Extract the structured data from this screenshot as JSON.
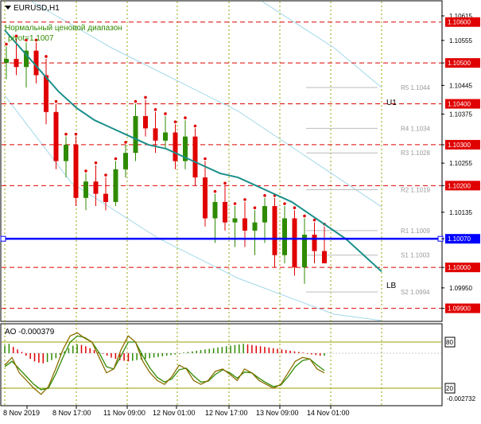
{
  "header": {
    "symbol": "EURUSD,H1",
    "indicator_name": "Нормальный ценовой диапазон",
    "pivot_label": "pivot=1.1007"
  },
  "colors": {
    "background": "#ffffff",
    "bull_candle": "#2e8b00",
    "bear_candle": "#e00000",
    "moving_average": "#1a8f8a",
    "channel": "#a0d8ea",
    "level_line": "#e00000",
    "price_line": "#0000ff",
    "ao_up": "#2e8b00",
    "ao_down": "#e00000",
    "stoch_main": "#8b6f00",
    "stoch_signal": "#2e8b00",
    "grid": "#9aa000",
    "axis": "#000000"
  },
  "chart_data": {
    "type": "candlestick",
    "main_panel": {
      "y_range": [
        1.0985,
        1.0865
      ],
      "y_range_note": "top to bottom",
      "tick_labels": [
        "1.10615",
        "1.10555",
        "1.10500",
        "1.10445",
        "1.10375",
        "1.10300",
        "1.10255",
        "1.10200",
        "1.10135",
        "1.10070",
        "1.10000",
        "1.09950",
        "1.09900"
      ],
      "tick_values": [
        1.10615,
        1.10555,
        1.105,
        1.10445,
        1.10375,
        1.103,
        1.10255,
        1.102,
        1.10135,
        1.1007,
        1.1,
        1.0995,
        1.099
      ],
      "red_levels": [
        1.106,
        1.105,
        1.104,
        1.103,
        1.102,
        1.1,
        1.099
      ],
      "red_level_labels": [
        "1.10600",
        "1.10500",
        "1.10400",
        "1.10300",
        "1.10200",
        "1.10000",
        "1.09900"
      ],
      "current_price": 1.1007,
      "current_price_label": "1.10070",
      "current_close": 1.1001,
      "pivot_labels": [
        {
          "text": "R5 1.1044",
          "value": 1.1044
        },
        {
          "text": "R4 1.1034",
          "value": 1.1034
        },
        {
          "text": "R3 1.1028",
          "value": 1.1028
        },
        {
          "text": "R2 1.1019",
          "value": 1.1019
        },
        {
          "text": "R1 1.1009",
          "value": 1.1009
        },
        {
          "text": "S1 1.1003",
          "value": 1.1003
        },
        {
          "text": "S2 1.0994",
          "value": 1.0994
        }
      ],
      "line_tags": [
        "U1",
        "LB"
      ],
      "ma_values": [
        1.1058,
        1.1053,
        1.1048,
        1.1043,
        1.1039,
        1.1036,
        1.1034,
        1.1032,
        1.103,
        1.1029,
        1.1027,
        1.1025,
        1.1023,
        1.1022,
        1.102,
        1.1018,
        1.1016,
        1.1013,
        1.101,
        1.1007,
        1.1003,
        1.0999
      ],
      "candles": [
        {
          "o": 1.105,
          "h": 1.1054,
          "l": 1.1046,
          "c": 1.1051
        },
        {
          "o": 1.1051,
          "h": 1.1056,
          "l": 1.1047,
          "c": 1.1049
        },
        {
          "o": 1.1049,
          "h": 1.1055,
          "l": 1.1044,
          "c": 1.1053
        },
        {
          "o": 1.1053,
          "h": 1.1055,
          "l": 1.1045,
          "c": 1.1047
        },
        {
          "o": 1.1047,
          "h": 1.1051,
          "l": 1.1035,
          "c": 1.1038
        },
        {
          "o": 1.1038,
          "h": 1.104,
          "l": 1.1024,
          "c": 1.1026
        },
        {
          "o": 1.1026,
          "h": 1.1032,
          "l": 1.1022,
          "c": 1.103
        },
        {
          "o": 1.103,
          "h": 1.1032,
          "l": 1.1015,
          "c": 1.1017
        },
        {
          "o": 1.1017,
          "h": 1.1023,
          "l": 1.1014,
          "c": 1.1021
        },
        {
          "o": 1.1021,
          "h": 1.1025,
          "l": 1.1015,
          "c": 1.1018
        },
        {
          "o": 1.1018,
          "h": 1.1022,
          "l": 1.1014,
          "c": 1.1016
        },
        {
          "o": 1.1016,
          "h": 1.1026,
          "l": 1.1015,
          "c": 1.1024
        },
        {
          "o": 1.1024,
          "h": 1.103,
          "l": 1.1022,
          "c": 1.1028
        },
        {
          "o": 1.1028,
          "h": 1.104,
          "l": 1.1026,
          "c": 1.1037
        },
        {
          "o": 1.1037,
          "h": 1.1041,
          "l": 1.1032,
          "c": 1.1034
        },
        {
          "o": 1.1034,
          "h": 1.1038,
          "l": 1.1028,
          "c": 1.1031
        },
        {
          "o": 1.1031,
          "h": 1.1037,
          "l": 1.1029,
          "c": 1.1033
        },
        {
          "o": 1.1033,
          "h": 1.1035,
          "l": 1.1024,
          "c": 1.1026
        },
        {
          "o": 1.1026,
          "h": 1.1036,
          "l": 1.1024,
          "c": 1.1032
        },
        {
          "o": 1.1032,
          "h": 1.1034,
          "l": 1.102,
          "c": 1.1022
        },
        {
          "o": 1.1022,
          "h": 1.1026,
          "l": 1.101,
          "c": 1.1012
        },
        {
          "o": 1.1012,
          "h": 1.1018,
          "l": 1.1006,
          "c": 1.1016
        },
        {
          "o": 1.1016,
          "h": 1.102,
          "l": 1.1009,
          "c": 1.1011
        },
        {
          "o": 1.1011,
          "h": 1.1015,
          "l": 1.1005,
          "c": 1.1012
        },
        {
          "o": 1.1012,
          "h": 1.1016,
          "l": 1.1005,
          "c": 1.1009
        },
        {
          "o": 1.1009,
          "h": 1.1014,
          "l": 1.1003,
          "c": 1.1011
        },
        {
          "o": 1.1011,
          "h": 1.1017,
          "l": 1.1006,
          "c": 1.1015
        },
        {
          "o": 1.1015,
          "h": 1.1017,
          "l": 1.1,
          "c": 1.1003
        },
        {
          "o": 1.1003,
          "h": 1.1015,
          "l": 1.1001,
          "c": 1.1012
        },
        {
          "o": 1.1012,
          "h": 1.1014,
          "l": 1.0998,
          "c": 1.1
        },
        {
          "o": 1.1,
          "h": 1.1012,
          "l": 1.0996,
          "c": 1.1008
        },
        {
          "o": 1.1008,
          "h": 1.1011,
          "l": 1.1001,
          "c": 1.1004
        },
        {
          "o": 1.1004,
          "h": 1.101,
          "l": 1.1001,
          "c": 1.1001
        }
      ]
    },
    "ao_panel": {
      "label": "AO",
      "value_label": "-0.000379",
      "value": -0.000379,
      "levels": [
        "80",
        "20"
      ],
      "bottom_label": "-0.002732",
      "histogram": [
        0.0012,
        0.0015,
        0.001,
        0.0006,
        0.0002,
        -0.0004,
        -0.0009,
        -0.0013,
        -0.0015,
        -0.0016,
        -0.0014,
        -0.0011,
        -0.0008,
        -0.0003,
        0.0003,
        0.0008,
        0.0012,
        0.0014,
        0.0013,
        0.0011,
        0.0008,
        0.0005,
        0.0002,
        -0.0001,
        -0.0004,
        -0.0007,
        -0.0009,
        -0.0011,
        -0.0012,
        -0.0013,
        -0.0012,
        -0.0011,
        -0.001,
        -0.0009,
        -0.0008,
        -0.0007,
        -0.0006,
        -0.0005,
        -0.0004,
        -0.0003,
        -0.0002,
        -0.0001,
        0.0001,
        0.0002,
        0.0003,
        0.0004,
        0.0005,
        0.0006,
        0.0007,
        0.0008,
        0.0009,
        0.001,
        0.0011,
        0.0012,
        0.0013,
        0.0014,
        0.0015,
        0.0014,
        0.0013,
        0.0012,
        0.0011,
        0.001,
        0.0009,
        0.0008,
        0.0007,
        0.0006,
        0.0005,
        0.0004,
        0.0003,
        0.0002,
        0.0001,
        -0.0001,
        -0.0002,
        -0.0003,
        -0.0004,
        -0.0004
      ],
      "stoch_main": [
        50,
        60,
        40,
        30,
        20,
        12,
        22,
        45,
        70,
        88,
        92,
        85,
        80,
        60,
        40,
        45,
        70,
        88,
        80,
        55,
        40,
        30,
        25,
        35,
        50,
        45,
        30,
        25,
        30,
        42,
        45,
        38,
        30,
        45,
        40,
        30,
        25,
        20,
        25,
        40,
        55,
        60,
        58,
        45,
        40
      ],
      "stoch_signal": [
        48,
        55,
        45,
        35,
        25,
        18,
        20,
        38,
        60,
        80,
        88,
        86,
        80,
        66,
        48,
        45,
        62,
        80,
        80,
        62,
        46,
        34,
        28,
        32,
        44,
        46,
        36,
        28,
        29,
        38,
        44,
        40,
        33,
        41,
        40,
        33,
        27,
        22,
        24,
        35,
        48,
        56,
        58,
        50,
        43
      ]
    },
    "x_tick_labels": [
      "8 Nov 2019",
      "8 Nov 17:00",
      "11 Nov 09:00",
      "12 Nov 01:00",
      "12 Nov 17:00",
      "13 Nov 09:00",
      "14 Nov 01:00"
    ]
  }
}
